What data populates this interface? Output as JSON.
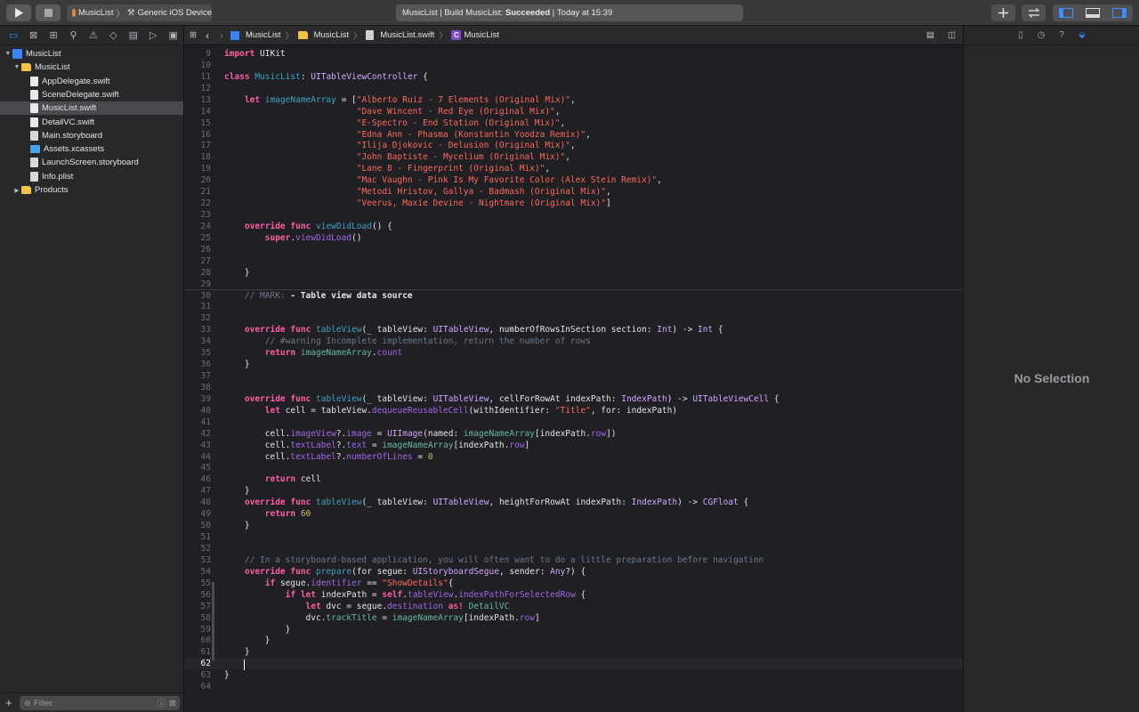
{
  "toolbar": {
    "scheme": "MusicList",
    "device": "Generic iOS Device",
    "status_project": "MusicList",
    "status_sep": "|",
    "status_action": "Build MusicList:",
    "status_result": "Succeeded",
    "status_time": "Today at 15:39",
    "icons": [
      "play-icon",
      "stop-icon",
      "plus-icon",
      "swap-icon",
      "navigator-toggle-icon",
      "debug-area-toggle-icon",
      "inspector-toggle-icon"
    ]
  },
  "navigator": {
    "tree": [
      {
        "label": "MusicList",
        "depth": 0,
        "kind": "xcodeproj",
        "disclosure": "down"
      },
      {
        "label": "MusicList",
        "depth": 1,
        "kind": "folder",
        "disclosure": "down"
      },
      {
        "label": "AppDelegate.swift",
        "depth": 2,
        "kind": "swift"
      },
      {
        "label": "SceneDelegate.swift",
        "depth": 2,
        "kind": "swift"
      },
      {
        "label": "MusicList.swift",
        "depth": 2,
        "kind": "swift",
        "selected": true
      },
      {
        "label": "DetailVC.swift",
        "depth": 2,
        "kind": "swift"
      },
      {
        "label": "Main.storyboard",
        "depth": 2,
        "kind": "storyboard"
      },
      {
        "label": "Assets.xcassets",
        "depth": 2,
        "kind": "xcassets"
      },
      {
        "label": "LaunchScreen.storyboard",
        "depth": 2,
        "kind": "storyboard"
      },
      {
        "label": "Info.plist",
        "depth": 2,
        "kind": "plist"
      },
      {
        "label": "Products",
        "depth": 1,
        "kind": "folder",
        "disclosure": "right"
      }
    ],
    "filter_placeholder": "Filter"
  },
  "jumpbar": {
    "items": [
      "MusicList",
      "MusicList",
      "MusicList.swift",
      "MusicList"
    ]
  },
  "editor": {
    "current_line": 62,
    "lines": [
      {
        "n": 9,
        "tokens": [
          [
            "kw",
            "import"
          ],
          [
            "plain",
            " UIKit"
          ]
        ]
      },
      {
        "n": 10,
        "tokens": []
      },
      {
        "n": 11,
        "tokens": [
          [
            "kw",
            "class"
          ],
          [
            "plain",
            " "
          ],
          [
            "decl",
            "MusicList"
          ],
          [
            "plain",
            ": "
          ],
          [
            "typ",
            "UITableViewController"
          ],
          [
            "plain",
            " {"
          ]
        ]
      },
      {
        "n": 12,
        "tokens": []
      },
      {
        "n": 13,
        "tokens": [
          [
            "plain",
            "    "
          ],
          [
            "kw",
            "let"
          ],
          [
            "plain",
            " "
          ],
          [
            "decl",
            "imageNameArray"
          ],
          [
            "plain",
            " = ["
          ],
          [
            "str",
            "\"Alberto Ruiz - 7 Elements (Original Mix)\""
          ],
          [
            "plain",
            ","
          ]
        ]
      },
      {
        "n": 14,
        "tokens": [
          [
            "plain",
            "                          "
          ],
          [
            "str",
            "\"Dave Wincent - Red Eye (Original Mix)\""
          ],
          [
            "plain",
            ","
          ]
        ]
      },
      {
        "n": 15,
        "tokens": [
          [
            "plain",
            "                          "
          ],
          [
            "str",
            "\"E-Spectro - End Station (Original Mix)\""
          ],
          [
            "plain",
            ","
          ]
        ]
      },
      {
        "n": 16,
        "tokens": [
          [
            "plain",
            "                          "
          ],
          [
            "str",
            "\"Edna Ann - Phasma (Konstantin Yoodza Remix)\""
          ],
          [
            "plain",
            ","
          ]
        ]
      },
      {
        "n": 17,
        "tokens": [
          [
            "plain",
            "                          "
          ],
          [
            "str",
            "\"Ilija Djokovic - Delusion (Original Mix)\""
          ],
          [
            "plain",
            ","
          ]
        ]
      },
      {
        "n": 18,
        "tokens": [
          [
            "plain",
            "                          "
          ],
          [
            "str",
            "\"John Baptiste - Mycelium (Original Mix)\""
          ],
          [
            "plain",
            ","
          ]
        ]
      },
      {
        "n": 19,
        "tokens": [
          [
            "plain",
            "                          "
          ],
          [
            "str",
            "\"Lane 8 - Fingerprint (Original Mix)\""
          ],
          [
            "plain",
            ","
          ]
        ]
      },
      {
        "n": 20,
        "tokens": [
          [
            "plain",
            "                          "
          ],
          [
            "str",
            "\"Mac Vaughn - Pink Is My Favorite Color (Alex Stein Remix)\""
          ],
          [
            "plain",
            ","
          ]
        ]
      },
      {
        "n": 21,
        "tokens": [
          [
            "plain",
            "                          "
          ],
          [
            "str",
            "\"Metodi Hristov, Gallya - Badmash (Original Mix)\""
          ],
          [
            "plain",
            ","
          ]
        ]
      },
      {
        "n": 22,
        "tokens": [
          [
            "plain",
            "                          "
          ],
          [
            "str",
            "\"Veerus, Maxie Devine - Nightmare (Original Mix)\""
          ],
          [
            "plain",
            "]"
          ]
        ]
      },
      {
        "n": 23,
        "tokens": []
      },
      {
        "n": 24,
        "tokens": [
          [
            "plain",
            "    "
          ],
          [
            "kw",
            "override"
          ],
          [
            "plain",
            " "
          ],
          [
            "kw",
            "func"
          ],
          [
            "plain",
            " "
          ],
          [
            "decl",
            "viewDidLoad"
          ],
          [
            "plain",
            "() {"
          ]
        ]
      },
      {
        "n": 25,
        "tokens": [
          [
            "plain",
            "        "
          ],
          [
            "kw",
            "super"
          ],
          [
            "plain",
            "."
          ],
          [
            "prop",
            "viewDidLoad"
          ],
          [
            "plain",
            "()"
          ]
        ]
      },
      {
        "n": 26,
        "tokens": []
      },
      {
        "n": 27,
        "tokens": []
      },
      {
        "n": 28,
        "tokens": [
          [
            "plain",
            "    }"
          ]
        ]
      },
      {
        "n": 29,
        "tokens": []
      },
      {
        "n": 30,
        "tokens": [
          [
            "cmt",
            "    // MARK: "
          ],
          [
            "boldw",
            "- Table view data source"
          ]
        ]
      },
      {
        "n": 31,
        "tokens": []
      },
      {
        "n": 32,
        "tokens": []
      },
      {
        "n": 33,
        "tokens": [
          [
            "plain",
            "    "
          ],
          [
            "kw",
            "override"
          ],
          [
            "plain",
            " "
          ],
          [
            "kw",
            "func"
          ],
          [
            "plain",
            " "
          ],
          [
            "decl",
            "tableView"
          ],
          [
            "plain",
            "(_ tableView: "
          ],
          [
            "typ",
            "UITableView"
          ],
          [
            "plain",
            ", numberOfRowsInSection section: "
          ],
          [
            "typ",
            "Int"
          ],
          [
            "plain",
            ") -> "
          ],
          [
            "typ",
            "Int"
          ],
          [
            "plain",
            " {"
          ]
        ]
      },
      {
        "n": 34,
        "tokens": [
          [
            "cmt",
            "        // #warning Incomplete implementation, return the number of rows"
          ]
        ]
      },
      {
        "n": 35,
        "tokens": [
          [
            "plain",
            "        "
          ],
          [
            "kw",
            "return"
          ],
          [
            "plain",
            " "
          ],
          [
            "fn",
            "imageNameArray"
          ],
          [
            "plain",
            "."
          ],
          [
            "prop",
            "count"
          ]
        ]
      },
      {
        "n": 36,
        "tokens": [
          [
            "plain",
            "    }"
          ]
        ]
      },
      {
        "n": 37,
        "tokens": []
      },
      {
        "n": 38,
        "tokens": []
      },
      {
        "n": 39,
        "tokens": [
          [
            "plain",
            "    "
          ],
          [
            "kw",
            "override"
          ],
          [
            "plain",
            " "
          ],
          [
            "kw",
            "func"
          ],
          [
            "plain",
            " "
          ],
          [
            "decl",
            "tableView"
          ],
          [
            "plain",
            "(_ tableView: "
          ],
          [
            "typ",
            "UITableView"
          ],
          [
            "plain",
            ", cellForRowAt indexPath: "
          ],
          [
            "typ",
            "IndexPath"
          ],
          [
            "plain",
            ") -> "
          ],
          [
            "typ",
            "UITableViewCell"
          ],
          [
            "plain",
            " {"
          ]
        ]
      },
      {
        "n": 40,
        "tokens": [
          [
            "plain",
            "        "
          ],
          [
            "kw",
            "let"
          ],
          [
            "plain",
            " cell = tableView."
          ],
          [
            "prop",
            "dequeueReusableCell"
          ],
          [
            "plain",
            "(withIdentifier: "
          ],
          [
            "str",
            "\"Title\""
          ],
          [
            "plain",
            ", for: indexPath)"
          ]
        ]
      },
      {
        "n": 41,
        "tokens": []
      },
      {
        "n": 42,
        "tokens": [
          [
            "plain",
            "        cell."
          ],
          [
            "prop",
            "imageView"
          ],
          [
            "plain",
            "?."
          ],
          [
            "prop",
            "image"
          ],
          [
            "plain",
            " = "
          ],
          [
            "typ",
            "UIImage"
          ],
          [
            "plain",
            "(named: "
          ],
          [
            "fn",
            "imageNameArray"
          ],
          [
            "plain",
            "[indexPath."
          ],
          [
            "prop",
            "row"
          ],
          [
            "plain",
            "])"
          ]
        ]
      },
      {
        "n": 43,
        "tokens": [
          [
            "plain",
            "        cell."
          ],
          [
            "prop",
            "textLabel"
          ],
          [
            "plain",
            "?."
          ],
          [
            "prop",
            "text"
          ],
          [
            "plain",
            " = "
          ],
          [
            "fn",
            "imageNameArray"
          ],
          [
            "plain",
            "[indexPath."
          ],
          [
            "prop",
            "row"
          ],
          [
            "plain",
            "]"
          ]
        ]
      },
      {
        "n": 44,
        "tokens": [
          [
            "plain",
            "        cell."
          ],
          [
            "prop",
            "textLabel"
          ],
          [
            "plain",
            "?."
          ],
          [
            "prop",
            "numberOfLines"
          ],
          [
            "plain",
            " = "
          ],
          [
            "num",
            "0"
          ]
        ]
      },
      {
        "n": 45,
        "tokens": []
      },
      {
        "n": 46,
        "tokens": [
          [
            "plain",
            "        "
          ],
          [
            "kw",
            "return"
          ],
          [
            "plain",
            " cell"
          ]
        ]
      },
      {
        "n": 47,
        "tokens": [
          [
            "plain",
            "    }"
          ]
        ]
      },
      {
        "n": 48,
        "tokens": [
          [
            "plain",
            "    "
          ],
          [
            "kw",
            "override"
          ],
          [
            "plain",
            " "
          ],
          [
            "kw",
            "func"
          ],
          [
            "plain",
            " "
          ],
          [
            "decl",
            "tableView"
          ],
          [
            "plain",
            "(_ tableView: "
          ],
          [
            "typ",
            "UITableView"
          ],
          [
            "plain",
            ", heightForRowAt indexPath: "
          ],
          [
            "typ",
            "IndexPath"
          ],
          [
            "plain",
            ") -> "
          ],
          [
            "typ",
            "CGFloat"
          ],
          [
            "plain",
            " {"
          ]
        ]
      },
      {
        "n": 49,
        "tokens": [
          [
            "plain",
            "        "
          ],
          [
            "kw",
            "return"
          ],
          [
            "plain",
            " "
          ],
          [
            "num",
            "60"
          ]
        ]
      },
      {
        "n": 50,
        "tokens": [
          [
            "plain",
            "    }"
          ]
        ]
      },
      {
        "n": 51,
        "tokens": []
      },
      {
        "n": 52,
        "tokens": []
      },
      {
        "n": 53,
        "tokens": [
          [
            "cmt",
            "    // In a storyboard-based application, you will often want to do a little preparation before navigation"
          ]
        ]
      },
      {
        "n": 54,
        "tokens": [
          [
            "plain",
            "    "
          ],
          [
            "kw",
            "override"
          ],
          [
            "plain",
            " "
          ],
          [
            "kw",
            "func"
          ],
          [
            "plain",
            " "
          ],
          [
            "decl",
            "prepare"
          ],
          [
            "plain",
            "(for segue: "
          ],
          [
            "typ",
            "UIStoryboardSegue"
          ],
          [
            "plain",
            ", sender: "
          ],
          [
            "typ",
            "Any"
          ],
          [
            "plain",
            "?) {"
          ]
        ]
      },
      {
        "n": 55,
        "tokens": [
          [
            "plain",
            "        "
          ],
          [
            "kw",
            "if"
          ],
          [
            "plain",
            " segue."
          ],
          [
            "prop",
            "identifier"
          ],
          [
            "plain",
            " == "
          ],
          [
            "str",
            "\"ShowDetails\""
          ],
          [
            "plain",
            "{"
          ]
        ]
      },
      {
        "n": 56,
        "tokens": [
          [
            "plain",
            "            "
          ],
          [
            "kw",
            "if"
          ],
          [
            "plain",
            " "
          ],
          [
            "kw",
            "let"
          ],
          [
            "plain",
            " indexPath = "
          ],
          [
            "kw",
            "self"
          ],
          [
            "plain",
            "."
          ],
          [
            "prop",
            "tableView"
          ],
          [
            "plain",
            "."
          ],
          [
            "prop",
            "indexPathForSelectedRow"
          ],
          [
            "plain",
            " {"
          ]
        ]
      },
      {
        "n": 57,
        "tokens": [
          [
            "plain",
            "                "
          ],
          [
            "kw",
            "let"
          ],
          [
            "plain",
            " dvc = segue."
          ],
          [
            "prop",
            "destination"
          ],
          [
            "plain",
            " "
          ],
          [
            "kw",
            "as!"
          ],
          [
            "plain",
            " "
          ],
          [
            "fn",
            "DetailVC"
          ]
        ]
      },
      {
        "n": 58,
        "tokens": [
          [
            "plain",
            "                dvc."
          ],
          [
            "fn",
            "trackTitle"
          ],
          [
            "plain",
            " = "
          ],
          [
            "fn",
            "imageNameArray"
          ],
          [
            "plain",
            "[indexPath."
          ],
          [
            "prop",
            "row"
          ],
          [
            "plain",
            "]"
          ]
        ]
      },
      {
        "n": 59,
        "tokens": [
          [
            "plain",
            "            }"
          ]
        ]
      },
      {
        "n": 60,
        "tokens": [
          [
            "plain",
            "        }"
          ]
        ]
      },
      {
        "n": 61,
        "tokens": [
          [
            "plain",
            "    }"
          ]
        ]
      },
      {
        "n": 62,
        "tokens": [
          [
            "plain",
            "    "
          ]
        ]
      },
      {
        "n": 63,
        "tokens": [
          [
            "plain",
            "}"
          ]
        ]
      },
      {
        "n": 64,
        "tokens": []
      }
    ]
  },
  "inspector": {
    "empty_label": "No Selection"
  },
  "colors": {
    "keyword": "#fc5fa3",
    "string": "#fc6a5d",
    "comment": "#6c7986",
    "type": "#d0a8ff",
    "accent": "#2f8cff"
  }
}
